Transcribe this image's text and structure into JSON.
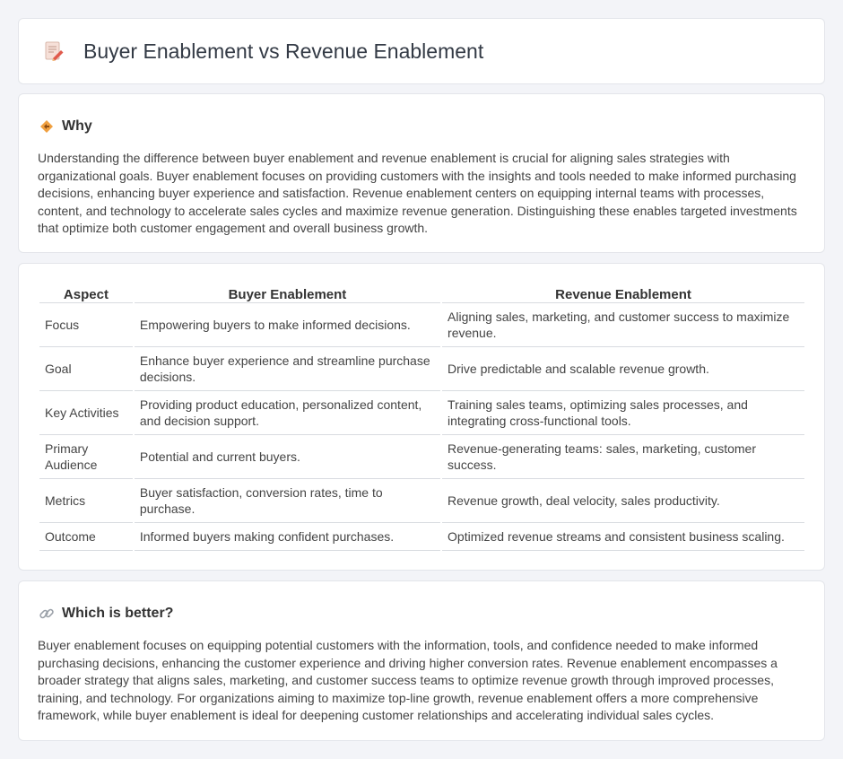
{
  "header": {
    "title": "Buyer Enablement vs Revenue Enablement",
    "icon": "document-pencil-icon"
  },
  "why": {
    "heading": "Why",
    "icon": "diamond-arrows-icon",
    "text": "Understanding the difference between buyer enablement and revenue enablement is crucial for aligning sales strategies with organizational goals. Buyer enablement focuses on providing customers with the insights and tools needed to make informed purchasing decisions, enhancing buyer experience and satisfaction. Revenue enablement centers on equipping internal teams with processes, content, and technology to accelerate sales cycles and maximize revenue generation. Distinguishing these enables targeted investments that optimize both customer engagement and overall business growth."
  },
  "table": {
    "headers": [
      "Aspect",
      "Buyer Enablement",
      "Revenue Enablement"
    ],
    "rows": [
      [
        "Focus",
        "Empowering buyers to make informed decisions.",
        "Aligning sales, marketing, and customer success to maximize revenue."
      ],
      [
        "Goal",
        "Enhance buyer experience and streamline purchase decisions.",
        "Drive predictable and scalable revenue growth."
      ],
      [
        "Key Activities",
        "Providing product education, personalized content, and decision support.",
        "Training sales teams, optimizing sales processes, and integrating cross-functional tools."
      ],
      [
        "Primary Audience",
        "Potential and current buyers.",
        "Revenue-generating teams: sales, marketing, customer success."
      ],
      [
        "Metrics",
        "Buyer satisfaction, conversion rates, time to purchase.",
        "Revenue growth, deal velocity, sales productivity."
      ],
      [
        "Outcome",
        "Informed buyers making confident purchases.",
        "Optimized revenue streams and consistent business scaling."
      ]
    ]
  },
  "better": {
    "heading": "Which is better?",
    "icon": "link-icon",
    "text": "Buyer enablement focuses on equipping potential customers with the information, tools, and confidence needed to make informed purchasing decisions, enhancing the customer experience and driving higher conversion rates. Revenue enablement encompasses a broader strategy that aligns sales, marketing, and customer success teams to optimize revenue growth through improved processes, training, and technology. For organizations aiming to maximize top-line growth, revenue enablement offers a more comprehensive framework, while buyer enablement is ideal for deepening customer relationships and accelerating individual sales cycles."
  },
  "colors": {
    "accent_orange": "#f0a040",
    "pencil_red": "#e05a4c"
  }
}
